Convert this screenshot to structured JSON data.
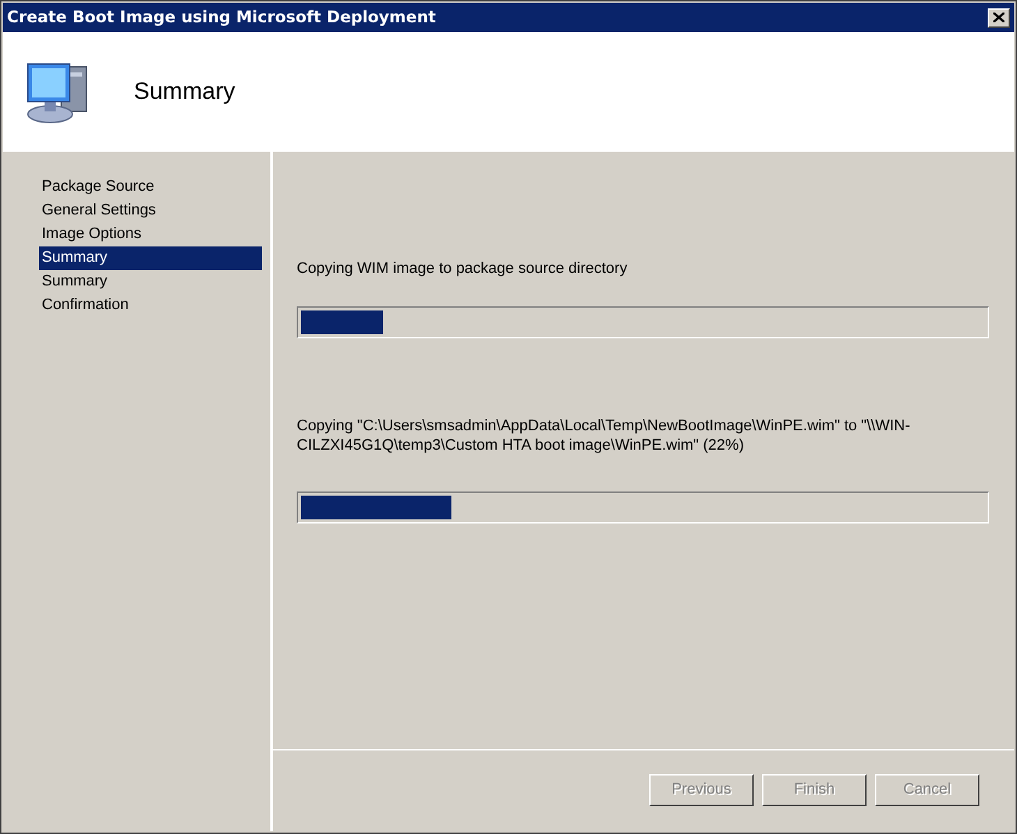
{
  "window": {
    "title": "Create Boot Image using Microsoft Deployment"
  },
  "header": {
    "title": "Summary"
  },
  "steps": [
    {
      "label": "Package Source",
      "selected": false
    },
    {
      "label": "General Settings",
      "selected": false
    },
    {
      "label": "Image Options",
      "selected": false
    },
    {
      "label": "Summary",
      "selected": true
    },
    {
      "label": "Summary",
      "selected": false
    },
    {
      "label": "Confirmation",
      "selected": false
    }
  ],
  "progress": [
    {
      "text": "Copying WIM image to package source directory",
      "level": 0.12
    },
    {
      "text": "Copying \"C:\\Users\\smsadmin\\AppData\\Local\\Temp\\NewBootImage\\WinPE.wim\" to \"\\\\WIN-CILZXI45G1Q\\temp3\\Custom HTA boot image\\WinPE.wim\" (22%)",
      "level": 0.22
    }
  ],
  "buttons": [
    {
      "label": "Previous",
      "disabled": true
    },
    {
      "label": "Finish",
      "disabled": true
    },
    {
      "label": "Cancel",
      "disabled": true
    }
  ]
}
